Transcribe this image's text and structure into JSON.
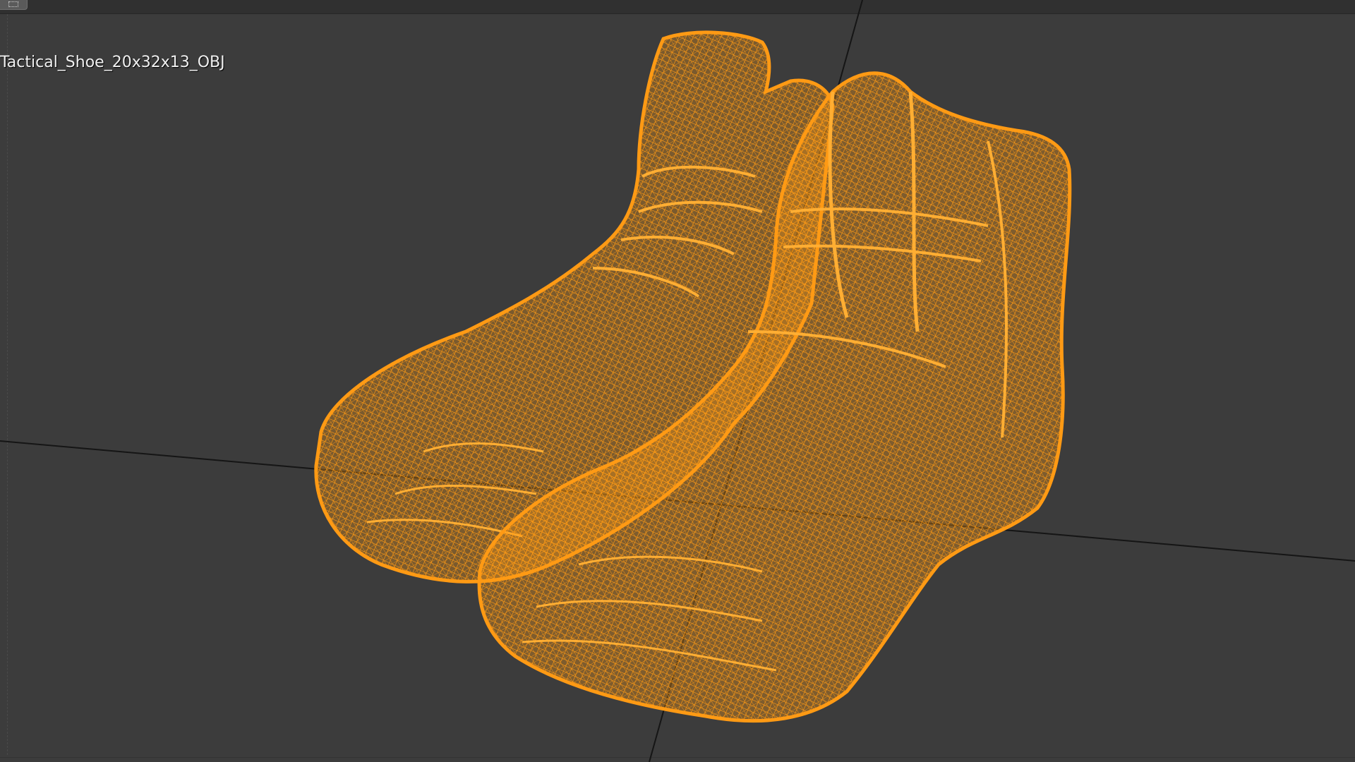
{
  "viewport": {
    "object_name": "Tactical_Shoe_20x32x13_OBJ",
    "background_color": "#3c3c3c",
    "wireframe_color": "#ff9a14",
    "axis_line_color": "#151515"
  },
  "icons": {
    "corner_widget": "editor-type-icon"
  },
  "scene": {
    "model": "boots-wireframe",
    "count": "2"
  }
}
